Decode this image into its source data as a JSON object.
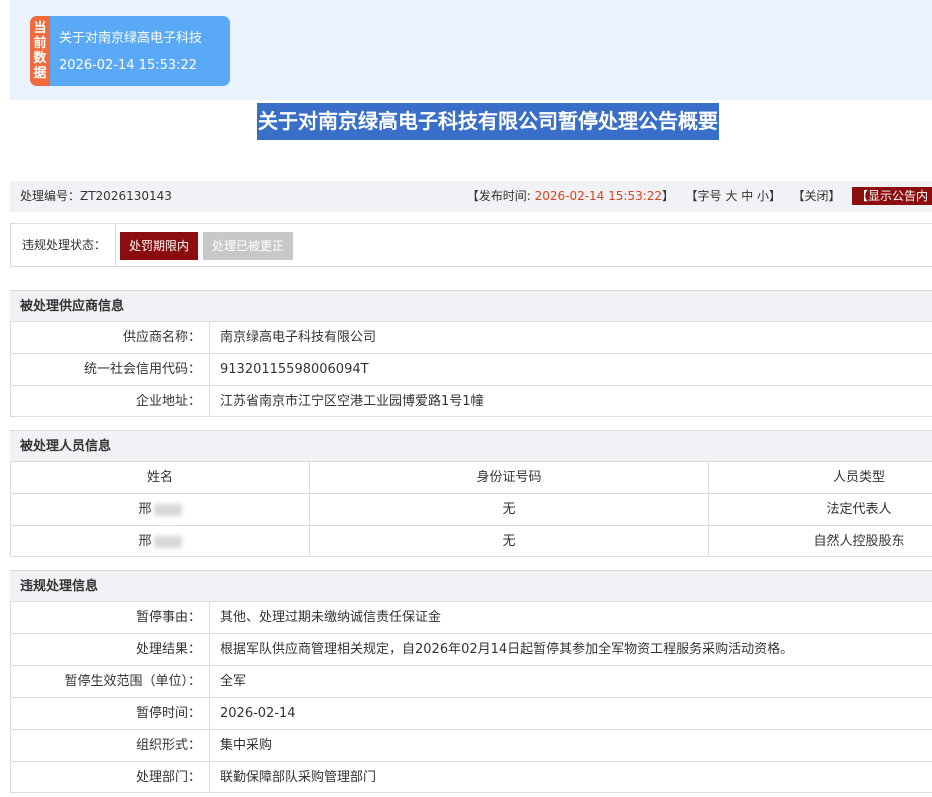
{
  "current_card": {
    "tag_chars": [
      "当",
      "前",
      "数",
      "据"
    ],
    "title": "关于对南京绿高电子科技",
    "time": "2026-02-14 15:53:22"
  },
  "page_title": "关于对南京绿高电子科技有限公司暂停处理公告概要",
  "meta": {
    "number": "处理编号：ZT2026130143",
    "publish_prefix": "【发布时间: ",
    "publish_time": "2026-02-14 15:53:22",
    "publish_suffix": "】",
    "font_size_label": "【字号",
    "font_large": "大",
    "font_medium": "中",
    "font_small": "小",
    "font_size_end": "】",
    "close": "【关闭】",
    "show_notice": "【显示公告内"
  },
  "status": {
    "label": "违规处理状态：",
    "active": "处罚期限内",
    "inactive": "处理已被更正"
  },
  "supplier": {
    "heading": "被处理供应商信息",
    "rows": [
      {
        "label": "供应商名称：",
        "value": "南京绿高电子科技有限公司"
      },
      {
        "label": "统一社会信用代码：",
        "value": "91320115598006094T"
      },
      {
        "label": "企业地址：",
        "value": "江苏省南京市江宁区空港工业园博爱路1号1幢"
      }
    ]
  },
  "personnel": {
    "heading": "被处理人员信息",
    "columns": [
      "姓名",
      "身份证号码",
      "人员类型"
    ],
    "rows": [
      {
        "name": "邢",
        "id": "无",
        "type": "法定代表人"
      },
      {
        "name": "邢",
        "id": "无",
        "type": "自然人控股股东"
      }
    ]
  },
  "violation": {
    "heading": "违规处理信息",
    "rows": [
      {
        "label": "暂停事由：",
        "value": "其他、处理过期未缴纳诚信责任保证金"
      },
      {
        "label": "处理结果：",
        "value": "根据军队供应商管理相关规定，自2026年02月14日起暂停其参加全军物资工程服务采购活动资格。"
      },
      {
        "label": "暂停生效范围（单位）：",
        "value": "全军"
      },
      {
        "label": "暂停时间：",
        "value": "2026-02-14"
      },
      {
        "label": "组织形式：",
        "value": "集中采购"
      },
      {
        "label": "处理部门：",
        "value": "联勤保障部队采购管理部门"
      }
    ]
  },
  "colors": {
    "accent_blue": "#5aa9f7",
    "tag_orange": "#f06a3c",
    "title_bg": "#3a6fc9",
    "dark_red": "#8c0d0d",
    "time_red": "#e2401c"
  }
}
